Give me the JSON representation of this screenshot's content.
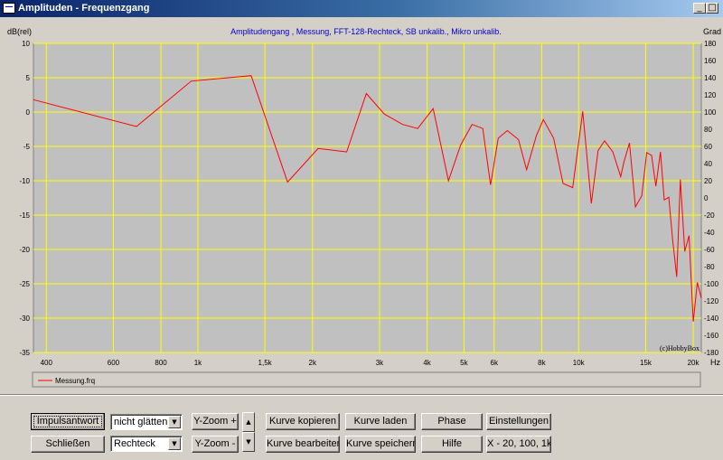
{
  "window": {
    "title": "Amplituden - Frequenzgang",
    "min_glyph": "_",
    "max_glyph": "□",
    "close_glyph": "X"
  },
  "chart_header": {
    "title": "Amplitudengang , Messung, FFT-128-Rechteck, SB unkalib., Mikro unkalib.",
    "left_unit": "dB(rel)",
    "right_unit": "Grad",
    "x_unit": "Hz",
    "watermark": "(c)HobbyBox"
  },
  "legend": {
    "entry": "Messung.frq"
  },
  "controls": {
    "impulse_button": "Impulsantwort",
    "close_button": "Schließen",
    "smoothing_value": "nicht glätten",
    "window_value": "Rechteck",
    "yzoom_plus": "Y-Zoom +",
    "yzoom_minus": "Y-Zoom  -",
    "up_glyph": "▲",
    "down_glyph": "▼",
    "copy_curve": "Kurve kopieren",
    "edit_curve": "Kurve bearbeiten",
    "load_curve": "Kurve laden",
    "save_curve": "Kurve speichern",
    "phase": "Phase",
    "help": "Hilfe",
    "settings": "Einstellungen",
    "x_zoom": "X - 20, 100, 1k",
    "dropdown_glyph": "▼"
  },
  "colors": {
    "plot_bg": "#c0c0c0",
    "grid": "#ffff00",
    "curve": "#ff0000",
    "header_text": "#0000cc"
  },
  "chart_data": {
    "type": "line",
    "xscale": "log",
    "xlim": [
      370,
      21000
    ],
    "ylim": [
      -35,
      10
    ],
    "y2lim": [
      -180,
      180
    ],
    "x_ticks": [
      {
        "v": 400,
        "label": "400"
      },
      {
        "v": 600,
        "label": "600"
      },
      {
        "v": 800,
        "label": "800"
      },
      {
        "v": 1000,
        "label": "1k"
      },
      {
        "v": 1500,
        "label": "1,5k"
      },
      {
        "v": 2000,
        "label": "2k"
      },
      {
        "v": 3000,
        "label": "3k"
      },
      {
        "v": 4000,
        "label": "4k"
      },
      {
        "v": 5000,
        "label": "5k"
      },
      {
        "v": 6000,
        "label": "6k"
      },
      {
        "v": 8000,
        "label": "8k"
      },
      {
        "v": 10000,
        "label": "10k"
      },
      {
        "v": 15000,
        "label": "15k"
      },
      {
        "v": 20000,
        "label": "20k"
      }
    ],
    "y_ticks": [
      10,
      5,
      0,
      -5,
      -10,
      -15,
      -20,
      -25,
      -30,
      -35
    ],
    "y2_ticks": [
      180,
      160,
      140,
      120,
      100,
      80,
      60,
      40,
      20,
      0,
      -20,
      -40,
      -60,
      -80,
      -100,
      -120,
      -140,
      -160,
      -180
    ],
    "grid": true,
    "series": [
      {
        "name": "Messung.frq",
        "x": [
          370,
          690,
          960,
          1380,
          1720,
          2070,
          2460,
          2770,
          3090,
          3450,
          3780,
          4150,
          4550,
          4900,
          5250,
          5600,
          5870,
          6150,
          6500,
          6950,
          7300,
          7750,
          8080,
          8600,
          9100,
          9650,
          10250,
          10800,
          11250,
          11700,
          12300,
          12900,
          13150,
          13600,
          14100,
          14650,
          15100,
          15550,
          15950,
          16400,
          16780,
          17250,
          17650,
          18100,
          18500,
          19000,
          19500,
          20000,
          20500,
          21000
        ],
        "y": [
          1.8,
          -2.1,
          4.5,
          5.3,
          -10.2,
          -5.3,
          -5.8,
          2.7,
          -0.3,
          -1.8,
          -2.4,
          0.5,
          -10,
          -4.8,
          -1.8,
          -2.4,
          -10.6,
          -3.8,
          -2.7,
          -4.0,
          -8.4,
          -3.4,
          -1.1,
          -3.8,
          -10.4,
          -11.0,
          0.1,
          -13.3,
          -5.6,
          -4.2,
          -5.8,
          -9.4,
          -7.3,
          -4.5,
          -13.8,
          -12.2,
          -5.9,
          -6.3,
          -10.8,
          -5.8,
          -12.8,
          -12.4,
          -18.5,
          -24.0,
          -9.8,
          -20.3,
          -18.0,
          -30.5,
          -24.8,
          -27.1
        ]
      }
    ]
  }
}
